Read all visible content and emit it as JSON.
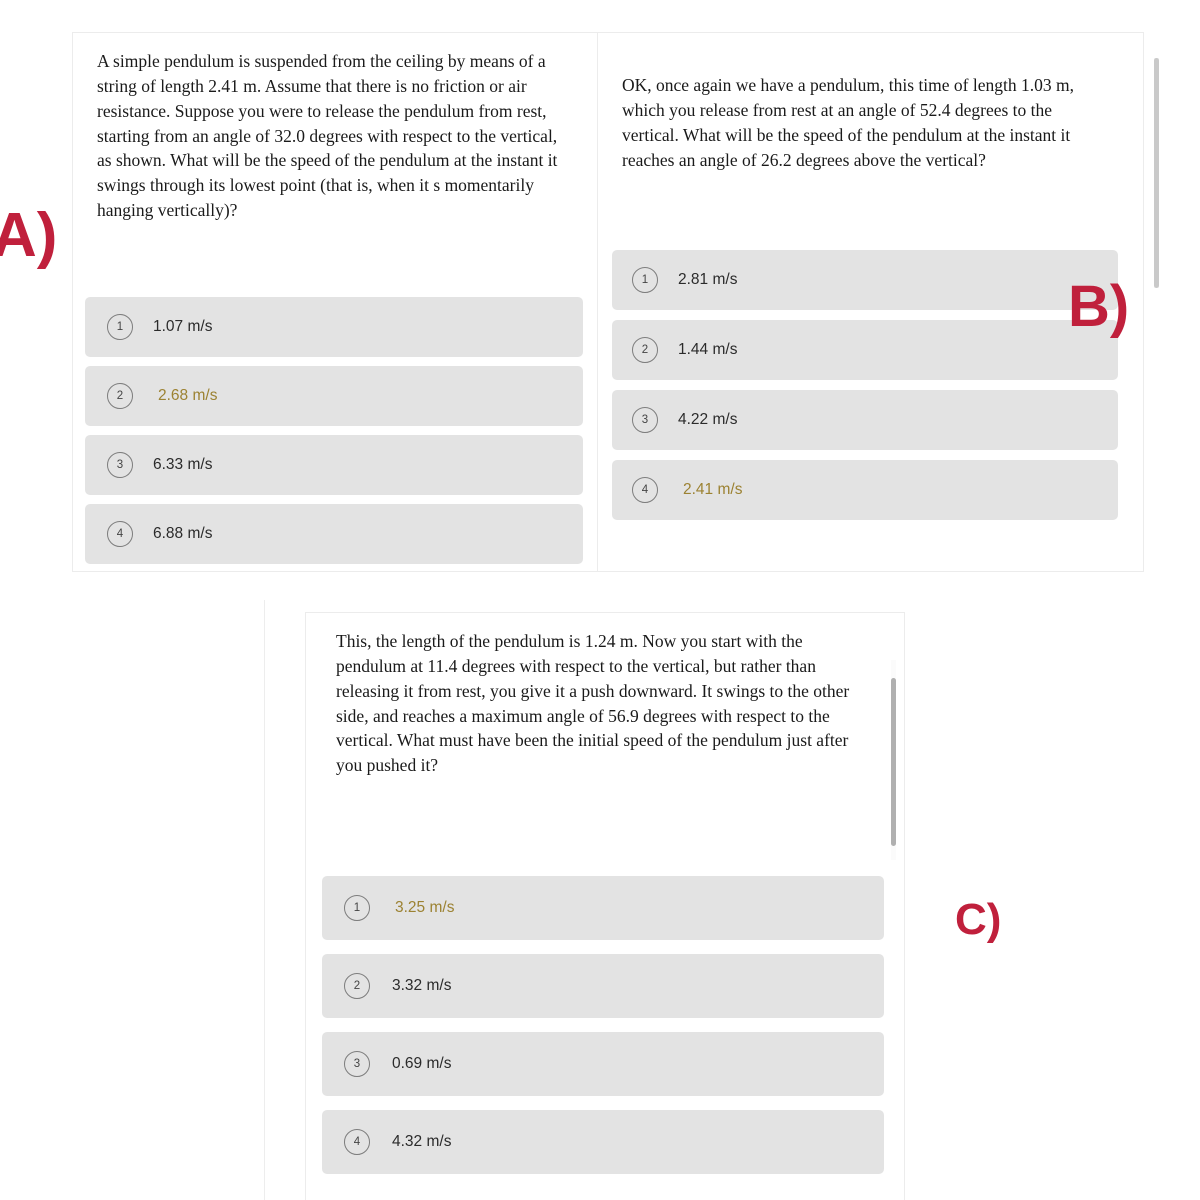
{
  "page": {
    "background": "#ffffff",
    "annotation_color": "#c0203c",
    "option_row_color": "#e3e3e3",
    "highlight_color": "#f4d678",
    "highlight_text_color": "#9c8232"
  },
  "annotations": [
    {
      "id": "a",
      "label": "A)"
    },
    {
      "id": "b",
      "label": "B)"
    },
    {
      "id": "c",
      "label": "C)"
    }
  ],
  "questions": [
    {
      "id": "question-a",
      "prompt": "A simple pendulum is suspended from the ceiling by means of a string of length 2.41 m. Assume that there is no friction or air resistance. Suppose you were to release the pendulum from rest, starting from an angle of 32.0 degrees with respect to the vertical, as shown. What will be the speed of the pendulum at the instant it swings through its lowest point (that is, when it s momentarily hanging vertically)?",
      "options": [
        {
          "number": "1",
          "label": "1.07 m/s",
          "highlighted": false
        },
        {
          "number": "2",
          "label": "2.68 m/s",
          "highlighted": true
        },
        {
          "number": "3",
          "label": "6.33 m/s",
          "highlighted": false
        },
        {
          "number": "4",
          "label": "6.88 m/s",
          "highlighted": false
        }
      ]
    },
    {
      "id": "question-b",
      "prompt": "OK, once again we have a pendulum, this time of length 1.03 m, which you release from rest at an angle of 52.4 degrees to the vertical. What will be the speed of the pendulum at the instant it reaches an angle of 26.2 degrees above the vertical?",
      "options": [
        {
          "number": "1",
          "label": "2.81 m/s",
          "highlighted": false
        },
        {
          "number": "2",
          "label": "1.44 m/s",
          "highlighted": false
        },
        {
          "number": "3",
          "label": "4.22 m/s",
          "highlighted": false
        },
        {
          "number": "4",
          "label": "2.41 m/s",
          "highlighted": true
        }
      ]
    },
    {
      "id": "question-c",
      "prompt": "This, the length of the pendulum is 1.24 m. Now you start with the pendulum at 11.4 degrees with respect to the vertical, but rather than releasing it from rest, you give it a push downward. It swings to the other side, and reaches a maximum angle of 56.9 degrees with respect to the vertical. What must have been the initial speed of the pendulum just after you pushed it?",
      "options": [
        {
          "number": "1",
          "label": "3.25 m/s",
          "highlighted": true
        },
        {
          "number": "2",
          "label": "3.32 m/s",
          "highlighted": false
        },
        {
          "number": "3",
          "label": "0.69 m/s",
          "highlighted": false
        },
        {
          "number": "4",
          "label": "4.32 m/s",
          "highlighted": false
        }
      ]
    }
  ]
}
